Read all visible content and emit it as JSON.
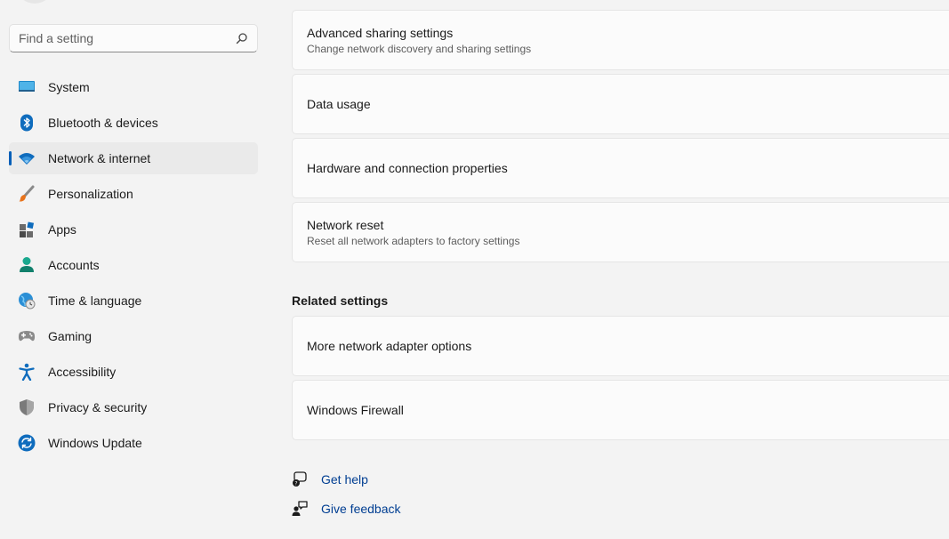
{
  "search": {
    "placeholder": "Find a setting"
  },
  "sidebar": {
    "items": [
      {
        "label": "System",
        "icon": "monitor-icon",
        "active": false
      },
      {
        "label": "Bluetooth & devices",
        "icon": "bluetooth-icon",
        "active": false
      },
      {
        "label": "Network & internet",
        "icon": "wifi-icon",
        "active": true
      },
      {
        "label": "Personalization",
        "icon": "brush-icon",
        "active": false
      },
      {
        "label": "Apps",
        "icon": "apps-icon",
        "active": false
      },
      {
        "label": "Accounts",
        "icon": "person-icon",
        "active": false
      },
      {
        "label": "Time & language",
        "icon": "globe-clock-icon",
        "active": false
      },
      {
        "label": "Gaming",
        "icon": "gamepad-icon",
        "active": false
      },
      {
        "label": "Accessibility",
        "icon": "accessibility-icon",
        "active": false
      },
      {
        "label": "Privacy & security",
        "icon": "shield-icon",
        "active": false
      },
      {
        "label": "Windows Update",
        "icon": "update-icon",
        "active": false
      }
    ]
  },
  "main": {
    "cards": [
      {
        "title": "Advanced sharing settings",
        "subtitle": "Change network discovery and sharing settings"
      },
      {
        "title": "Data usage",
        "subtitle": ""
      },
      {
        "title": "Hardware and connection properties",
        "subtitle": ""
      },
      {
        "title": "Network reset",
        "subtitle": "Reset all network adapters to factory settings"
      }
    ],
    "related_title": "Related settings",
    "related": [
      {
        "title": "More network adapter options"
      },
      {
        "title": "Windows Firewall"
      }
    ],
    "help": {
      "get_help": "Get help",
      "give_feedback": "Give feedback"
    }
  },
  "colors": {
    "accent": "#005fb8",
    "link": "#003e92",
    "background": "#f3f3f3",
    "card": "#fbfbfb"
  }
}
